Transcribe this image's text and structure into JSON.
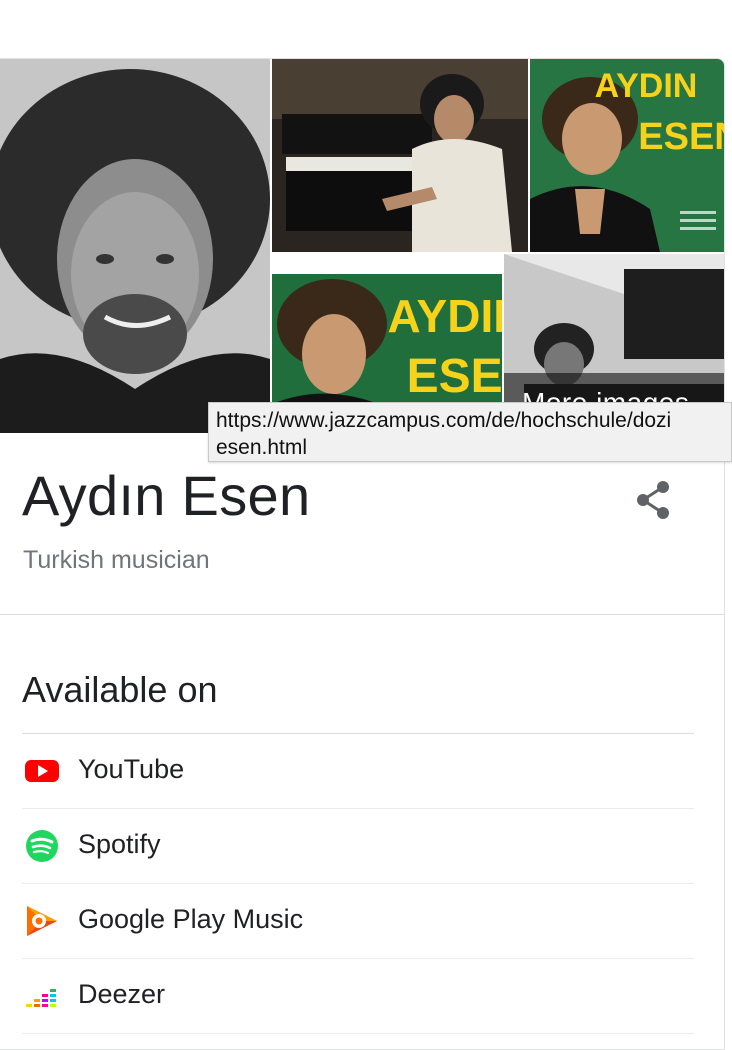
{
  "images": {
    "more_images_label": "More images",
    "tiles": [
      {
        "name": "portrait-photo"
      },
      {
        "name": "piano-photo"
      },
      {
        "name": "album-cover-1",
        "cover_text_top": "AYDIN",
        "cover_text_bottom": "ESEN"
      },
      {
        "name": "album-cover-2",
        "cover_text_top": "AYDIN",
        "cover_text_bottom": "ESEN"
      },
      {
        "name": "bw-photo"
      }
    ]
  },
  "tooltip": {
    "line1": "https://www.jazzcampus.com/de/hochschule/dozi",
    "line2": "esen.html"
  },
  "entity": {
    "title": "Aydın Esen",
    "subtitle": "Turkish musician",
    "share_icon": "share-icon"
  },
  "available_on": {
    "heading": "Available on",
    "items": [
      {
        "label": "YouTube",
        "icon": "youtube-icon",
        "color": "#ff0000"
      },
      {
        "label": "Spotify",
        "icon": "spotify-icon",
        "color": "#1ed760"
      },
      {
        "label": "Google Play Music",
        "icon": "google-play-music-icon",
        "color": "#ff6d00"
      },
      {
        "label": "Deezer",
        "icon": "deezer-icon",
        "color": "#ff0092"
      }
    ]
  }
}
